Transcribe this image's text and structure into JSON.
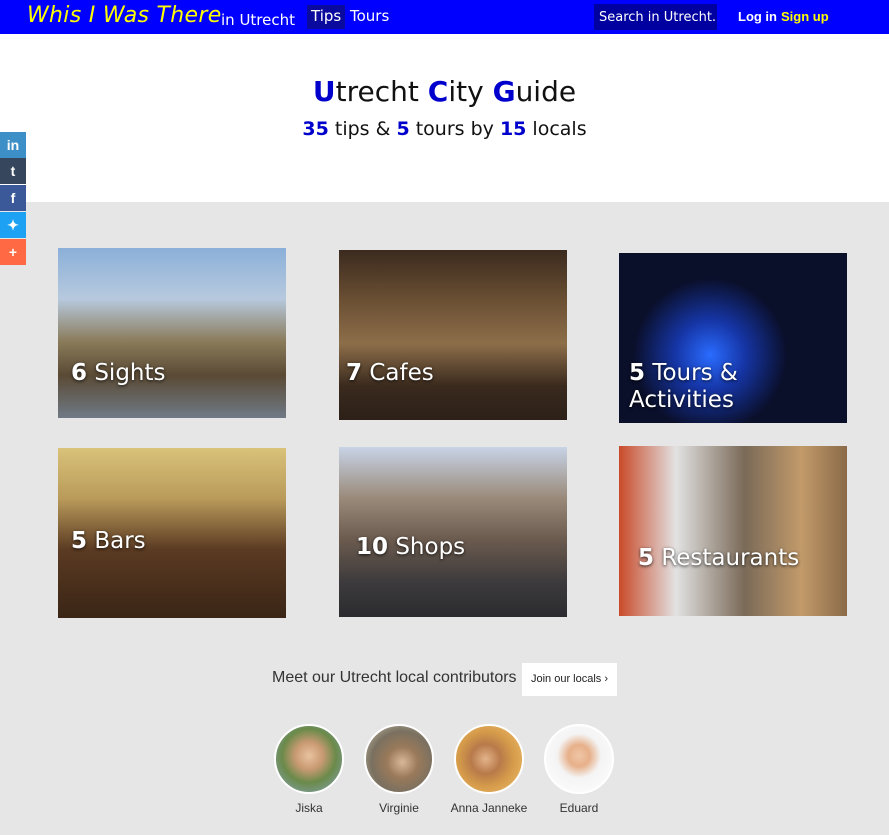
{
  "nav": {
    "brand": "Whis I Was There",
    "brand_suffix": "in Utrecht",
    "tips": "Tips",
    "tours": "Tours",
    "search_placeholder": "Search in Utrecht...",
    "login": "Log in",
    "signup": "Sign up"
  },
  "header": {
    "title_u": "U",
    "title_1": "trecht ",
    "title_c": "C",
    "title_2": "ity ",
    "title_g": "G",
    "title_3": "uide",
    "tips_count": "35",
    "tips_text": " tips & ",
    "tours_count": "5",
    "tours_text": " tours by ",
    "locals_count": "15",
    "locals_text": " locals"
  },
  "social": [
    {
      "icon": "linkedin-icon",
      "glyph": "in",
      "color": "#3d8fc7"
    },
    {
      "icon": "tumblr-icon",
      "glyph": "t",
      "color": "#36465d"
    },
    {
      "icon": "facebook-icon",
      "glyph": "f",
      "color": "#3b5998"
    },
    {
      "icon": "twitter-icon",
      "glyph": "✦",
      "color": "#1da1f2"
    },
    {
      "icon": "more-icon",
      "glyph": "+",
      "color": "#ff6a44"
    }
  ],
  "categories": [
    {
      "count": "6",
      "name": "Sights"
    },
    {
      "count": "7",
      "name": "Cafes"
    },
    {
      "count": "5",
      "name": "Tours & Activities"
    },
    {
      "count": "5",
      "name": "Bars"
    },
    {
      "count": "10",
      "name": "Shops"
    },
    {
      "count": "5",
      "name": "Restaurants"
    }
  ],
  "contributors": {
    "heading": "Meet our Utrecht local contributors",
    "join": "Join our locals ›",
    "people": [
      "Jiska",
      "Virginie",
      "Anna Janneke",
      "Eduard"
    ]
  },
  "colors": {
    "nav_bg": "#0000ff",
    "brand": "#ffff00",
    "accent": "#0000cc"
  }
}
